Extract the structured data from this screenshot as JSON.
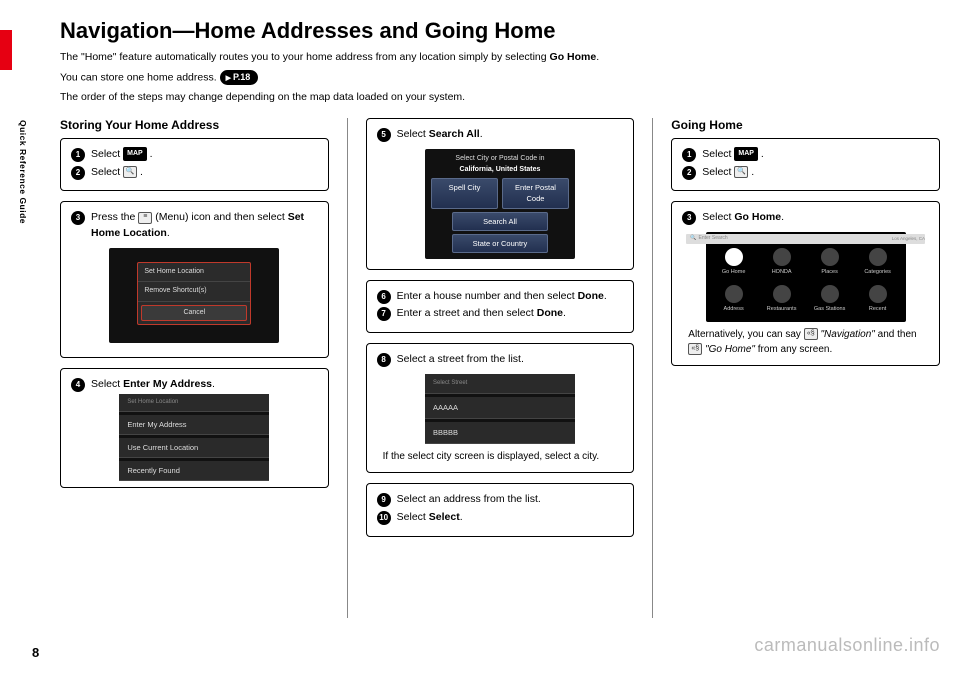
{
  "page_number": "8",
  "side_label": "Quick Reference Guide",
  "watermark": "carmanualsonline.info",
  "title": "Navigation—Home Addresses and Going Home",
  "intro1_a": "The \"Home\" feature automatically routes you to your home address from any location simply by selecting ",
  "intro1_b": "Go Home",
  "intro1_c": ".",
  "intro2": "You can store one home address.",
  "pref": "P.18",
  "intro3": "The order of the steps may change depending on the map data loaded on your system.",
  "col1": {
    "heading": "Storing Your Home Address",
    "step1": "Select ",
    "map_label": "MAP",
    "step2": "Select ",
    "step3_a": "Press the ",
    "step3_b": " (Menu) icon and then select ",
    "step3_c": "Set Home Location",
    "dialog": {
      "opt1": "Set Home Location",
      "opt2": "Remove Shortcut(s)",
      "cancel": "Cancel"
    },
    "step4_a": "Select ",
    "step4_b": "Enter My Address",
    "list": {
      "i1": "Enter My Address",
      "i2": "Use Current Location",
      "i3": "Recently Found"
    }
  },
  "col2": {
    "step5_a": "Select ",
    "step5_b": "Search All",
    "ss_header_a": "Select City or Postal Code in",
    "ss_header_b": "California, United States",
    "btn1": "Spell City",
    "btn2": "Enter Postal Code",
    "btn3": "Search All",
    "btn4": "State or Country",
    "step6_a": "Enter a house number and then select ",
    "step6_b": "Done",
    "step7_a": "Enter a street and then select ",
    "step7_b": "Done",
    "step8": "Select a street from the list.",
    "list": {
      "r1": "AAAAA",
      "r2": "BBBBB"
    },
    "note8": "If the select city screen is displayed, select a city.",
    "step9": "Select an address from the list.",
    "step10_a": "Select ",
    "step10_b": "Select"
  },
  "col3": {
    "heading": "Going Home",
    "step1": "Select ",
    "step2": "Select ",
    "step3_a": "Select ",
    "step3_b": "Go Home",
    "search_placeholder": "Enter Search",
    "search_hint": "Los Angeles, CA",
    "icons": [
      "Go Home",
      "HONDA",
      "Places",
      "Categories",
      "Address",
      "Restaurants",
      "Gas Stations",
      "Recent"
    ],
    "alt_a": "Alternatively, you can say ",
    "alt_b": "\"Navigation\"",
    "alt_c": " and then ",
    "alt_d": "\"Go Home\"",
    "alt_e": " from any screen."
  }
}
